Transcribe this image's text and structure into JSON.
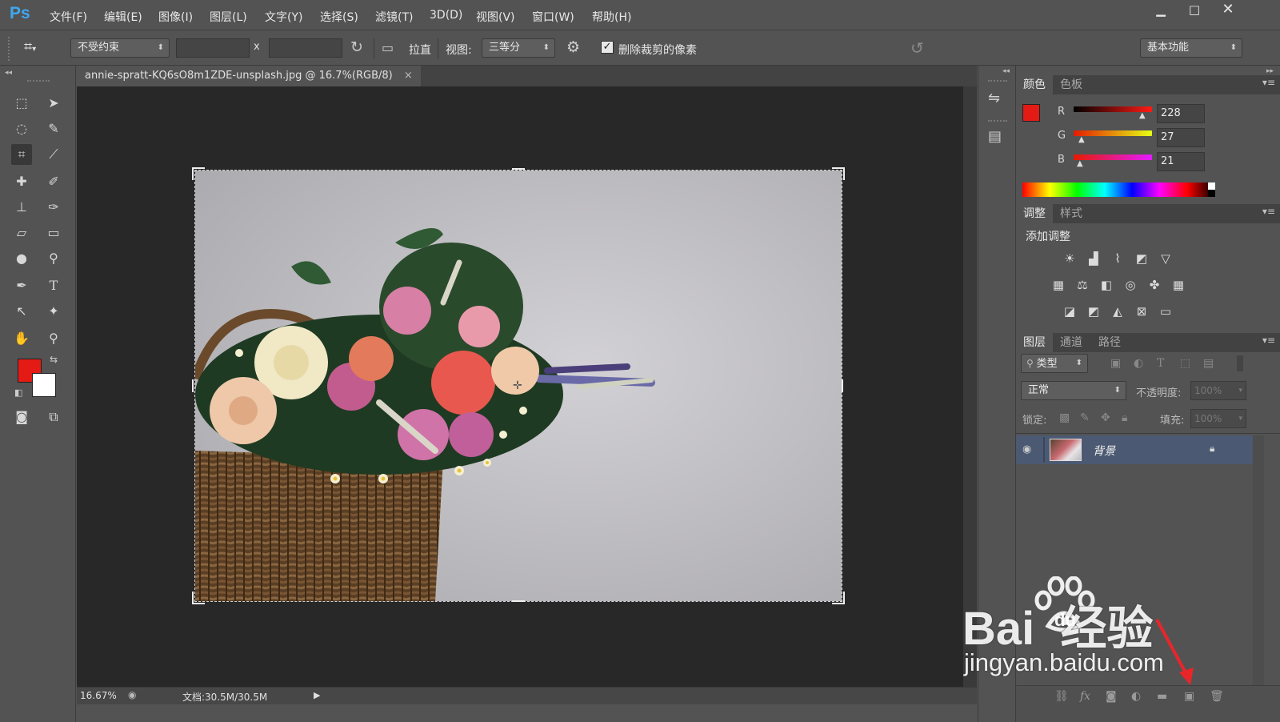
{
  "app": {
    "logo": "Ps"
  },
  "menu": [
    "文件(F)",
    "编辑(E)",
    "图像(I)",
    "图层(L)",
    "文字(Y)",
    "选择(S)",
    "滤镜(T)",
    "3D(D)",
    "视图(V)",
    "窗口(W)",
    "帮助(H)"
  ],
  "window_controls": {
    "minimize": "▁",
    "maximize": "□",
    "close": "✕"
  },
  "options": {
    "constraint": "不受约束",
    "x_sep": "x",
    "straighten": "拉直",
    "view_label": "视图:",
    "view_value": "三等分",
    "delete_cropped": "删除裁剪的像素",
    "delete_cropped_checked": true,
    "workspace": "基本功能"
  },
  "document": {
    "tab_title": "annie-spratt-KQ6sO8m1ZDE-unsplash.jpg @ 16.7%(RGB/8)",
    "tab_close": "×"
  },
  "status": {
    "zoom": "16.67%",
    "doc_size": "文档:30.5M/30.5M"
  },
  "color_panel": {
    "tabs": [
      "颜色",
      "色板"
    ],
    "fg_color": "#e41b15",
    "bg_color": "#ffffff",
    "r_label": "R",
    "g_label": "G",
    "b_label": "B",
    "r": "228",
    "g": "27",
    "b": "21"
  },
  "adjust_panel": {
    "tabs": [
      "调整",
      "样式"
    ],
    "title": "添加调整"
  },
  "layers_panel": {
    "tabs": [
      "图层",
      "通道",
      "路径"
    ],
    "filter": "类型",
    "blend_mode": "正常",
    "opacity_label": "不透明度:",
    "opacity_value": "100%",
    "lock_label": "锁定:",
    "fill_label": "填充:",
    "fill_value": "100%",
    "layer_name": "背景"
  },
  "watermark": {
    "brand": "Bai  经验",
    "du": "du",
    "url": "jingyan.baidu.com"
  },
  "colors": {
    "ui_bg": "#535353",
    "canvas_bg": "#282828",
    "accent_blue": "#3fa7f0",
    "fg": "#e41b15"
  }
}
